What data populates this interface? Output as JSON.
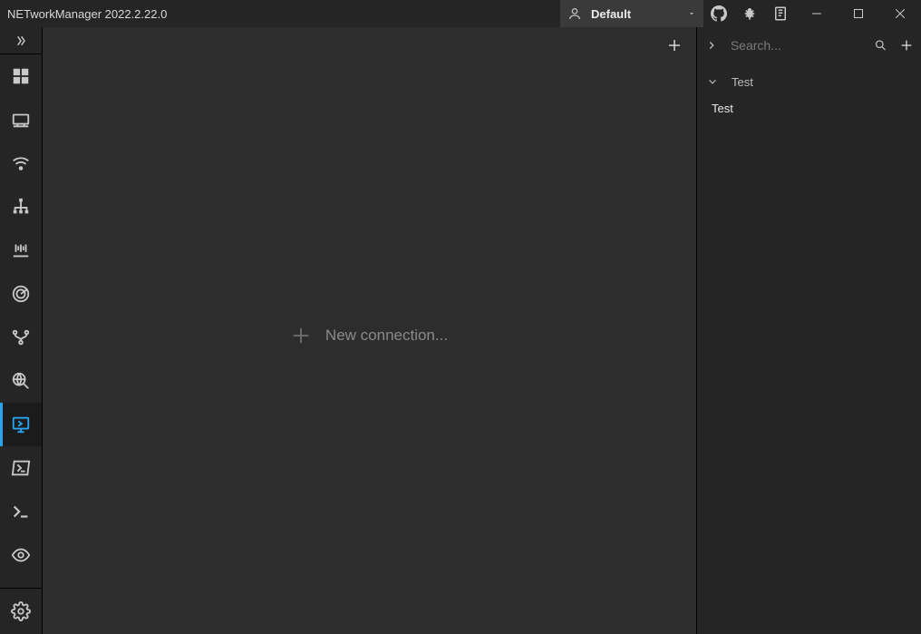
{
  "app": {
    "title": "NETworkManager 2022.2.22.0"
  },
  "profile_dropdown": {
    "selected": "Default"
  },
  "titlebar_icons": [
    {
      "name": "github-icon"
    },
    {
      "name": "bug-icon"
    },
    {
      "name": "docs-icon"
    }
  ],
  "nav": {
    "items": [
      {
        "name": "dashboard",
        "active": false
      },
      {
        "name": "network-interface",
        "active": false
      },
      {
        "name": "wifi",
        "active": false
      },
      {
        "name": "ip-scanner",
        "active": false
      },
      {
        "name": "port-scanner",
        "active": false
      },
      {
        "name": "ping-monitor",
        "active": false
      },
      {
        "name": "traceroute",
        "active": false
      },
      {
        "name": "dns-lookup",
        "active": false
      },
      {
        "name": "remote-desktop",
        "active": true
      },
      {
        "name": "powershell",
        "active": false
      },
      {
        "name": "putty",
        "active": false
      },
      {
        "name": "tightvnc",
        "active": false
      }
    ]
  },
  "center": {
    "new_connection_label": "New connection..."
  },
  "right_panel": {
    "search_placeholder": "Search...",
    "groups": [
      {
        "name": "Test",
        "expanded": true,
        "profiles": [
          {
            "name": "Test"
          }
        ]
      }
    ]
  }
}
